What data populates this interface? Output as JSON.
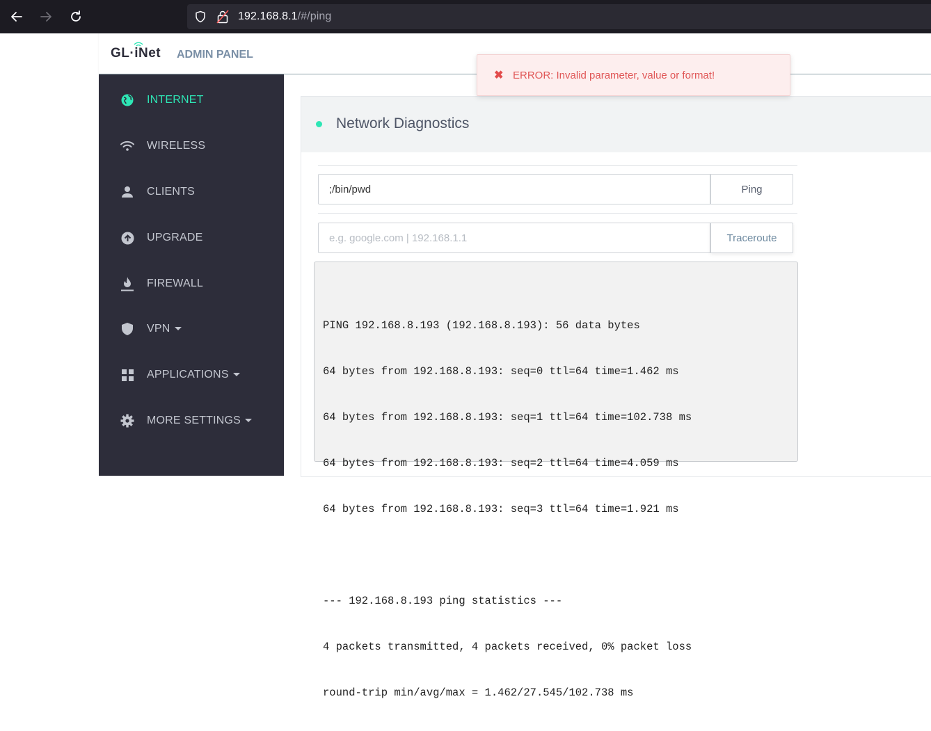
{
  "browser": {
    "url_host": "192.168.8.1",
    "url_path": "/#/ping"
  },
  "header": {
    "logo": "GL·iNet",
    "subtitle": "ADMIN PANEL"
  },
  "sidebar": {
    "items": [
      {
        "label": "INTERNET",
        "icon": "globe-icon",
        "active": true,
        "has_dropdown": false
      },
      {
        "label": "WIRELESS",
        "icon": "wifi-icon",
        "active": false,
        "has_dropdown": false
      },
      {
        "label": "CLIENTS",
        "icon": "user-icon",
        "active": false,
        "has_dropdown": false
      },
      {
        "label": "UPGRADE",
        "icon": "upload-circle-icon",
        "active": false,
        "has_dropdown": false
      },
      {
        "label": "FIREWALL",
        "icon": "flame-icon",
        "active": false,
        "has_dropdown": false
      },
      {
        "label": "VPN",
        "icon": "shield-icon",
        "active": false,
        "has_dropdown": true
      },
      {
        "label": "APPLICATIONS",
        "icon": "grid-icon",
        "active": false,
        "has_dropdown": true
      },
      {
        "label": "MORE SETTINGS",
        "icon": "gear-icon",
        "active": false,
        "has_dropdown": true
      }
    ]
  },
  "panel": {
    "title": "Network Diagnostics"
  },
  "ping": {
    "value": ";/bin/pwd",
    "button": "Ping"
  },
  "traceroute": {
    "placeholder": "e.g. google.com | 192.168.1.1",
    "value": "",
    "button": "Traceroute"
  },
  "output": {
    "lines": [
      "PING 192.168.8.193 (192.168.8.193): 56 data bytes",
      "64 bytes from 192.168.8.193: seq=0 ttl=64 time=1.462 ms",
      "64 bytes from 192.168.8.193: seq=1 ttl=64 time=102.738 ms",
      "64 bytes from 192.168.8.193: seq=2 ttl=64 time=4.059 ms",
      "64 bytes from 192.168.8.193: seq=3 ttl=64 time=1.921 ms",
      "",
      "--- 192.168.8.193 ping statistics ---",
      "4 packets transmitted, 4 packets received, 0% packet loss",
      "round-trip min/avg/max = 1.462/27.545/102.738 ms"
    ]
  },
  "toast": {
    "message": "ERROR: Invalid parameter, value or format!"
  },
  "colors": {
    "accent": "#2ee6b5",
    "sidebar_bg": "#2d2d3a",
    "error": "#e05656"
  }
}
